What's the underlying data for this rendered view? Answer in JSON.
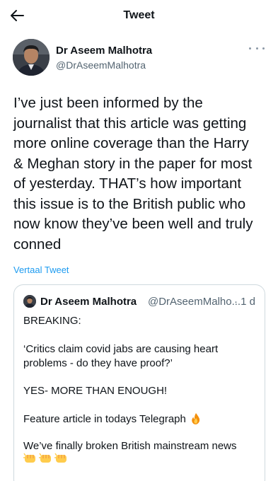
{
  "header": {
    "title": "Tweet"
  },
  "tweet": {
    "author_name": "Dr Aseem Malhotra",
    "author_handle": "@DrAseemMalhotra",
    "text_lines": [
      "I’ve just been informed by the",
      "journalist that this article was getting",
      "more online coverage than the Harry",
      "& Meghan story in the paper for most",
      "of yesterday. THAT’s how important",
      "this issue is to the British public who",
      "now know they’ve been well and truly",
      "conned"
    ],
    "translate_label": "Vertaal Tweet"
  },
  "quote": {
    "author_name": "Dr Aseem Malhotra",
    "author_handle": "@DrAseemMalho...",
    "time": "· 1 d",
    "breaking": "BREAKING:",
    "quote_line1": "‘Critics claim covid jabs are causing heart",
    "quote_line2": "problems - do they have proof?’",
    "enough": "YES- MORE THAN ENOUGH!",
    "feature": "Feature article in todays Telegraph",
    "broken": "We’ve finally broken British mainstream news"
  },
  "icons": {
    "back": "arrow-left-icon",
    "more": "more-dots-icon",
    "fire": "fire-emoji",
    "fist": "fist-bump-emoji"
  },
  "colors": {
    "link": "#1d9bf0",
    "secondary_text": "#536471",
    "border": "#cfd9de"
  }
}
